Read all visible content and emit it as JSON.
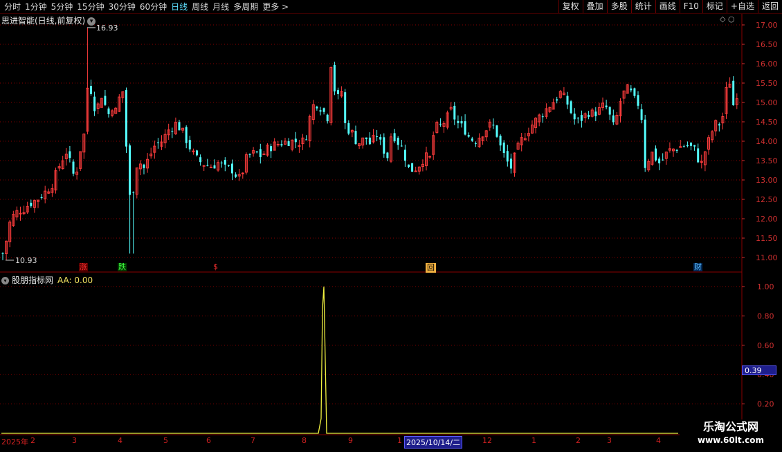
{
  "toolbar": {
    "periods": [
      "分时",
      "1分钟",
      "5分钟",
      "15分钟",
      "30分钟",
      "60分钟",
      "日线",
      "周线",
      "月线",
      "多周期",
      "更多 >"
    ],
    "active_period": "日线",
    "actions": [
      "复权",
      "叠加",
      "多股",
      "统计",
      "画线",
      "F10",
      "标记",
      "+自选",
      "返回"
    ]
  },
  "main_panel": {
    "title": "思进智能(日线,前复权)",
    "high_marker": "16.93",
    "low_marker": "10.93",
    "signals": [
      {
        "label": "涨",
        "color": "#ff3030",
        "bg": "#5a0000"
      },
      {
        "label": "跌",
        "color": "#40ff40",
        "bg": "#003a00"
      },
      {
        "label": "$",
        "color": "#ff3030",
        "bg": "#000"
      },
      {
        "label": "回",
        "color": "#000",
        "bg": "#f0b040"
      },
      {
        "label": "财",
        "color": "#60c0ff",
        "bg": "#002a5a"
      }
    ]
  },
  "indicator_panel": {
    "title": "股朋指标网",
    "aa_label": "AA: 0.00",
    "cursor_value": "0.39"
  },
  "date_axis": {
    "labels": [
      "2025年",
      "2",
      "3",
      "4",
      "5",
      "6",
      "7",
      "8",
      "9",
      "1",
      "12",
      "1",
      "2",
      "3",
      "4"
    ],
    "cursor_date": "2025/10/14/二"
  },
  "watermark": {
    "line1": "乐淘公式网",
    "line2": "www.60lt.com"
  },
  "colors": {
    "up": "#ff3c3c",
    "down": "#54ffff",
    "indicator": "#f0f040",
    "grid": "#8a0000",
    "axis_text": "#d03030"
  },
  "chart_data": [
    {
      "type": "candlestick",
      "title": "思进智能(日线,前复权)",
      "ylim": [
        10.8,
        17.2
      ],
      "yticks": [
        "17.00",
        "16.50",
        "16.00",
        "15.50",
        "15.00",
        "14.50",
        "14.00",
        "13.50",
        "13.00",
        "12.50",
        "12.00",
        "11.50",
        "11.00"
      ],
      "max": 16.93,
      "min": 10.93,
      "close_path": [
        [
          0,
          11.1
        ],
        [
          4,
          11.3
        ],
        [
          8,
          11.8
        ],
        [
          14,
          12.05
        ],
        [
          22,
          12.2
        ],
        [
          30,
          12.25
        ],
        [
          40,
          12.4
        ],
        [
          50,
          12.5
        ],
        [
          62,
          12.7
        ],
        [
          72,
          12.9
        ],
        [
          80,
          13.3
        ],
        [
          88,
          13.6
        ],
        [
          94,
          13.8
        ],
        [
          100,
          13.1
        ],
        [
          108,
          13.3
        ],
        [
          114,
          14.0
        ],
        [
          118,
          14.2
        ],
        [
          122,
          15.2
        ],
        [
          124,
          16.1
        ],
        [
          128,
          15.2
        ],
        [
          134,
          14.8
        ],
        [
          140,
          15.0
        ],
        [
          146,
          15.4
        ],
        [
          150,
          14.4
        ],
        [
          156,
          15.0
        ],
        [
          162,
          14.7
        ],
        [
          168,
          15.1
        ],
        [
          174,
          15.3
        ],
        [
          178,
          14.0
        ],
        [
          182,
          13.0
        ],
        [
          186,
          11.9
        ],
        [
          190,
          13.2
        ],
        [
          196,
          13.5
        ],
        [
          204,
          13.3
        ],
        [
          212,
          13.6
        ],
        [
          220,
          13.9
        ],
        [
          230,
          14.0
        ],
        [
          240,
          14.3
        ],
        [
          250,
          14.45
        ],
        [
          258,
          14.3
        ],
        [
          266,
          14.0
        ],
        [
          274,
          13.7
        ],
        [
          282,
          13.5
        ],
        [
          292,
          13.4
        ],
        [
          302,
          13.35
        ],
        [
          312,
          13.45
        ],
        [
          320,
          13.3
        ],
        [
          330,
          13.3
        ],
        [
          338,
          13.1
        ],
        [
          344,
          13.0
        ],
        [
          350,
          13.5
        ],
        [
          358,
          13.65
        ],
        [
          366,
          13.7
        ],
        [
          374,
          13.6
        ],
        [
          382,
          13.8
        ],
        [
          392,
          13.9
        ],
        [
          402,
          13.95
        ],
        [
          412,
          14.0
        ],
        [
          422,
          14.0
        ],
        [
          432,
          13.95
        ],
        [
          440,
          14.2
        ],
        [
          446,
          14.85
        ],
        [
          452,
          15.0
        ],
        [
          458,
          14.9
        ],
        [
          464,
          14.75
        ],
        [
          470,
          14.6
        ],
        [
          474,
          16.05
        ],
        [
          478,
          15.4
        ],
        [
          484,
          15.1
        ],
        [
          490,
          15.3
        ],
        [
          496,
          14.2
        ],
        [
          502,
          14.35
        ],
        [
          508,
          14.05
        ],
        [
          516,
          13.95
        ],
        [
          524,
          14.1
        ],
        [
          532,
          13.9
        ],
        [
          540,
          14.2
        ],
        [
          548,
          13.85
        ],
        [
          556,
          13.6
        ],
        [
          562,
          14.25
        ],
        [
          570,
          14.0
        ],
        [
          578,
          13.8
        ],
        [
          586,
          13.3
        ],
        [
          594,
          13.25
        ],
        [
          602,
          13.4
        ],
        [
          610,
          13.6
        ],
        [
          618,
          13.55
        ],
        [
          624,
          14.4
        ],
        [
          630,
          14.35
        ],
        [
          636,
          14.45
        ],
        [
          642,
          14.6
        ],
        [
          648,
          14.8
        ],
        [
          654,
          14.55
        ],
        [
          660,
          14.4
        ],
        [
          666,
          14.35
        ],
        [
          674,
          14.1
        ],
        [
          682,
          14.0
        ],
        [
          690,
          14.15
        ],
        [
          698,
          14.3
        ],
        [
          706,
          14.45
        ],
        [
          712,
          14.3
        ],
        [
          720,
          13.8
        ],
        [
          728,
          13.5
        ],
        [
          734,
          13.3
        ],
        [
          740,
          13.6
        ],
        [
          746,
          13.9
        ],
        [
          752,
          14.1
        ],
        [
          760,
          14.3
        ],
        [
          768,
          14.5
        ],
        [
          776,
          14.65
        ],
        [
          784,
          14.8
        ],
        [
          792,
          14.95
        ],
        [
          800,
          15.1
        ],
        [
          806,
          15.25
        ],
        [
          812,
          15.1
        ],
        [
          818,
          14.9
        ],
        [
          824,
          14.6
        ],
        [
          830,
          14.5
        ],
        [
          838,
          14.6
        ],
        [
          846,
          14.75
        ],
        [
          854,
          14.7
        ],
        [
          862,
          14.8
        ],
        [
          870,
          14.95
        ],
        [
          878,
          14.6
        ],
        [
          884,
          14.3
        ],
        [
          890,
          14.9
        ],
        [
          896,
          15.2
        ],
        [
          902,
          15.35
        ],
        [
          910,
          15.2
        ],
        [
          916,
          14.9
        ],
        [
          922,
          15.1
        ],
        [
          926,
          13.3
        ],
        [
          932,
          13.5
        ],
        [
          938,
          13.7
        ],
        [
          944,
          13.55
        ],
        [
          950,
          13.4
        ],
        [
          956,
          13.6
        ],
        [
          962,
          13.75
        ],
        [
          970,
          13.8
        ],
        [
          978,
          13.85
        ],
        [
          986,
          13.9
        ],
        [
          994,
          13.85
        ],
        [
          1002,
          13.75
        ],
        [
          1008,
          13.3
        ],
        [
          1014,
          13.7
        ],
        [
          1020,
          14.0
        ],
        [
          1026,
          14.3
        ],
        [
          1032,
          14.5
        ],
        [
          1038,
          14.4
        ],
        [
          1044,
          15.0
        ],
        [
          1048,
          15.8
        ],
        [
          1052,
          15.4
        ],
        [
          1056,
          14.9
        ],
        [
          1062,
          15.3
        ]
      ]
    },
    {
      "type": "line",
      "title": "股朋指标网",
      "series": [
        {
          "name": "AA",
          "x": [
            0,
            458,
            462,
            464,
            466,
            470,
            978
          ],
          "values": [
            0,
            0,
            0.1,
            0.85,
            1.0,
            0,
            0
          ]
        }
      ],
      "ylim": [
        0,
        1.08
      ],
      "yticks": [
        "1.00",
        "0.80",
        "0.60",
        "0.40",
        "0.20"
      ]
    }
  ]
}
